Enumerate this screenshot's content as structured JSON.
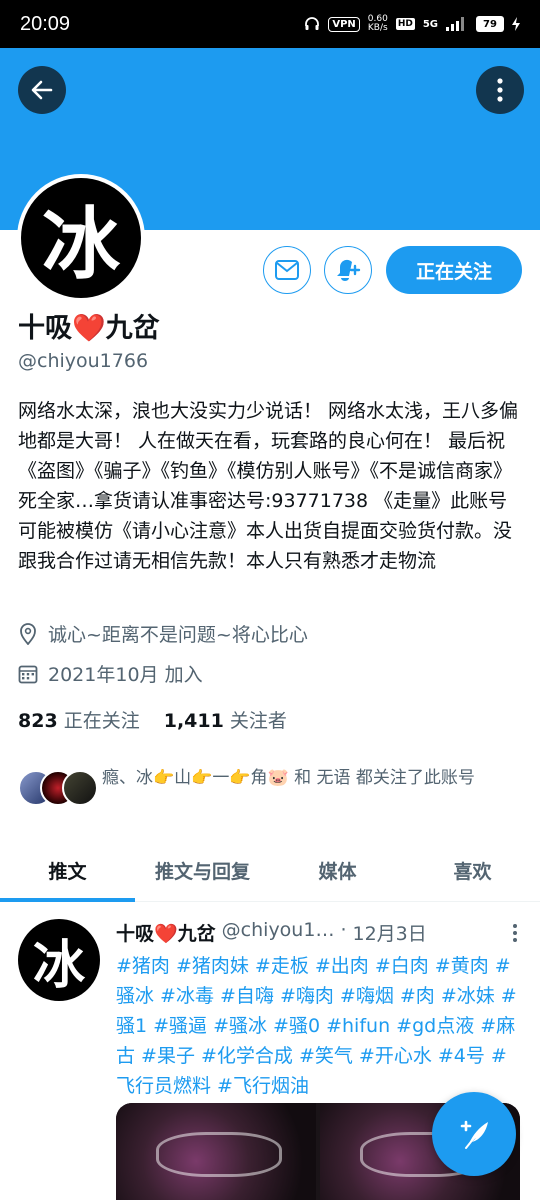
{
  "status_bar": {
    "time": "20:09",
    "vpn": "VPN",
    "speed_top": "0.60",
    "speed_bottom": "KB/s",
    "hd": "HD",
    "network": "5G",
    "battery": "79"
  },
  "profile": {
    "display_name": "十吸❤️九岔",
    "handle": "@chiyou1766",
    "follow_button_label": "正在关注",
    "avatar_glyph": "冰",
    "bio": "网络水太深，浪也大没实力少说话！ 网络水太浅，王八多偏地都是大哥！ 人在做天在看，玩套路的良心何在！ 最后祝《盗图》《骗子》《钓鱼》《模仿别人账号》《不是诚信商家》死全家…拿货请认准事密达号:93771738 《走量》此账号可能被模仿《请小心注意》本人出货自提面交验货付款。没跟我合作过请无相信先款！本人只有熟悉才走物流",
    "location": "诚心~距离不是问题~将心比心",
    "joined": "2021年10月 加入",
    "following_count": "823",
    "following_label": "正在关注",
    "followers_count": "1,411",
    "followers_label": "关注者",
    "followed_by_text": "瘾、冰👉山👉一👉角🐷 和 无语 都关注了此账号"
  },
  "tabs": [
    {
      "label": "推文",
      "active": true
    },
    {
      "label": "推文与回复",
      "active": false
    },
    {
      "label": "媒体",
      "active": false
    },
    {
      "label": "喜欢",
      "active": false
    }
  ],
  "tweet": {
    "author_name": "十吸❤️九岔",
    "author_handle": "@chiyou1…",
    "dot": "·",
    "date": "12月3日",
    "text": "#猪肉 #猪肉妹 #走板 #出肉 #白肉 #黄肉 #骚冰 #冰毒 #自嗨 #嗨肉 #嗨烟 #肉 #冰妹 #骚1 #骚逼 #骚冰 #骚0 #hifun #gd点液 #麻古 #果子 #化学合成 #笑气 #开心水 #4号 #飞行员燃料 #飞行烟油"
  },
  "colors": {
    "accent": "#1d9bf0",
    "text_primary": "#0f1419",
    "text_secondary": "#536471"
  },
  "icons": {
    "back": "arrow-left-icon",
    "more": "more-vertical-icon",
    "message": "envelope-icon",
    "notify": "bell-plus-icon",
    "location": "location-pin-icon",
    "calendar": "calendar-icon",
    "compose": "feather-plus-icon"
  }
}
